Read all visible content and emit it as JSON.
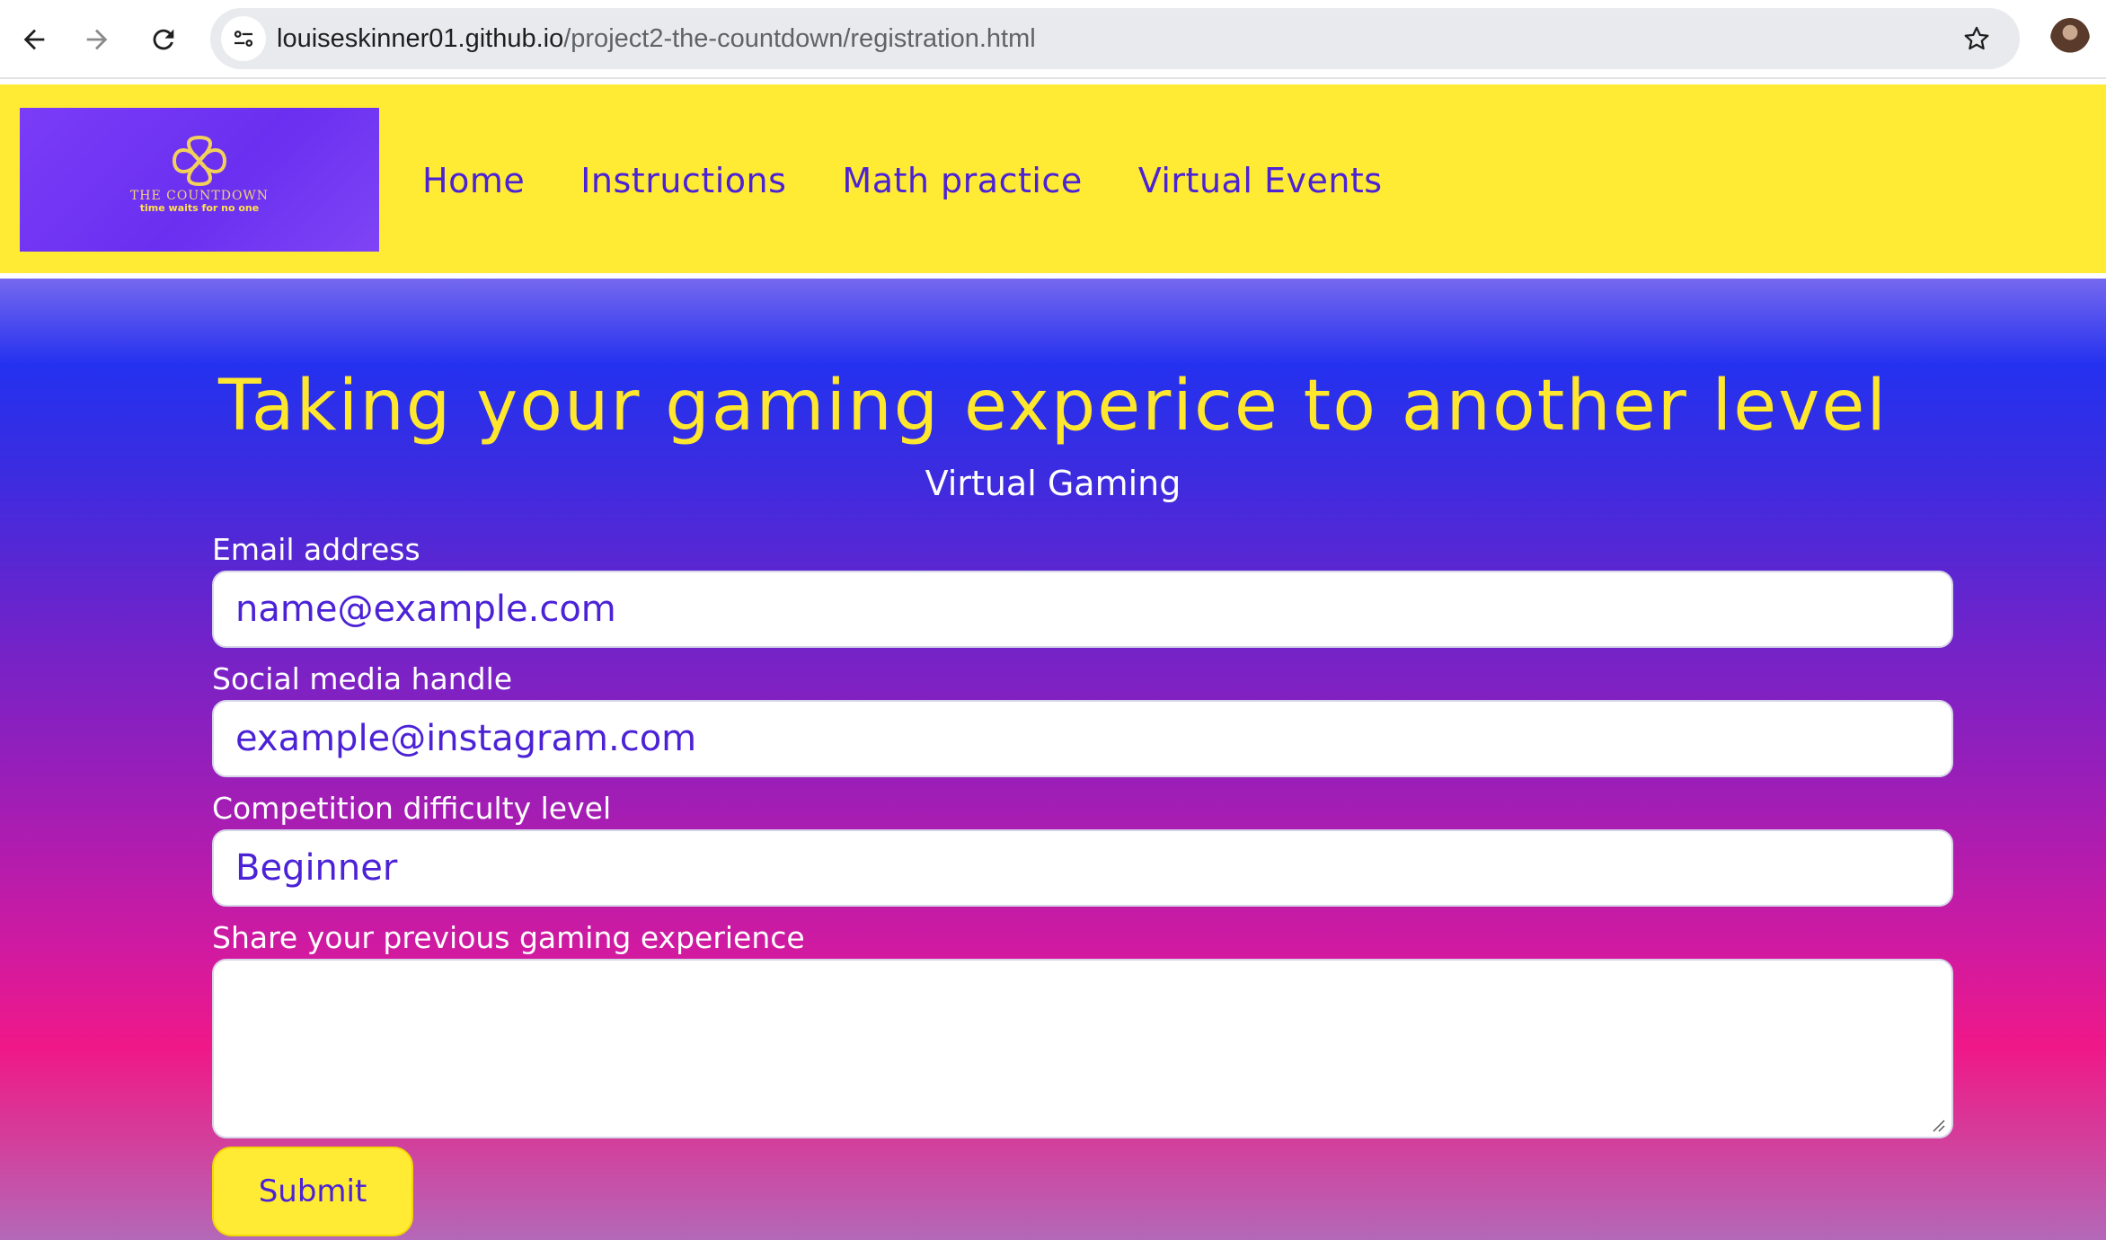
{
  "browser": {
    "url_host": "louiseskinner01.github.io",
    "url_path": "/project2-the-countdown/registration.html"
  },
  "header": {
    "logo_title": "THE COUNTDOWN",
    "logo_tagline": "time waits for no one",
    "nav": [
      {
        "label": "Home"
      },
      {
        "label": "Instructions"
      },
      {
        "label": "Math practice"
      },
      {
        "label": "Virtual Events"
      }
    ]
  },
  "main": {
    "title": "Taking your gaming experice to another level",
    "subtitle": "Virtual Gaming",
    "form": {
      "email_label": "Email address",
      "email_placeholder": "name@example.com",
      "social_label": "Social media handle",
      "social_placeholder": "example@instagram.com",
      "difficulty_label": "Competition difficulty level",
      "difficulty_value": "Beginner",
      "experience_label": "Share your previous gaming experience",
      "experience_value": "",
      "submit_label": "Submit"
    }
  },
  "colors": {
    "header_bg": "#ffeb33",
    "nav_text": "#4b22d6",
    "title_yellow": "#ffe72e",
    "gradient_top": "#2431ef",
    "gradient_bottom": "#f01888"
  },
  "icons": {
    "back": "arrow-left-icon",
    "forward": "arrow-right-icon",
    "reload": "reload-icon",
    "site_info": "tune-icon",
    "bookmark": "star-icon",
    "logo": "infinity-knot-icon"
  }
}
